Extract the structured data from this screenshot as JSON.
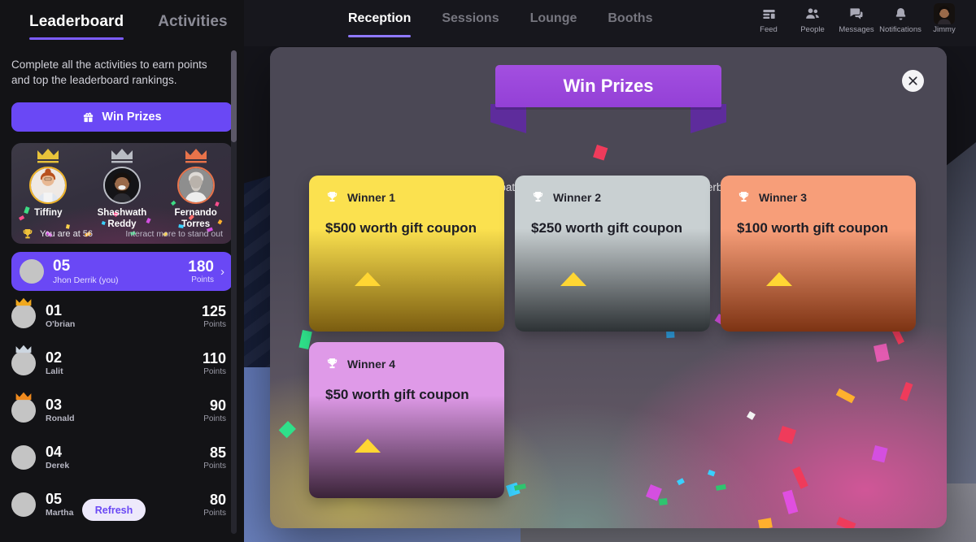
{
  "sidebar": {
    "tabs": [
      {
        "label": "Leaderboard",
        "active": true
      },
      {
        "label": "Activities",
        "active": false
      }
    ],
    "description": "Complete all the activities to earn points and top the leaderboard rankings.",
    "win_prizes_label": "Win Prizes",
    "win_prizes_icon": "gift-icon",
    "podium": [
      {
        "name": "Tiffiny",
        "medal": "gold",
        "crown_color": "#e8c33a"
      },
      {
        "name": "Shashwath Reddy",
        "medal": "silver",
        "crown_color": "#b9bcc4"
      },
      {
        "name": "Fernando Torres",
        "medal": "bronze",
        "crown_color": "#e8734a"
      }
    ],
    "podium_status": "You are at 56",
    "podium_status_icon": "trophy-icon",
    "podium_hint": "Interact more to stand out",
    "self": {
      "rank": "05",
      "name": "Jhon Derrik (you)",
      "points": "180",
      "points_label": "Points",
      "chevron": "›"
    },
    "list": [
      {
        "rank": "01",
        "name": "O'brian",
        "points": "125",
        "points_label": "Points",
        "crown": "gold"
      },
      {
        "rank": "02",
        "name": "Lalit",
        "points": "110",
        "points_label": "Points",
        "crown": "silver"
      },
      {
        "rank": "03",
        "name": "Ronald",
        "points": "90",
        "points_label": "Points",
        "crown": "bronze"
      },
      {
        "rank": "04",
        "name": "Derek",
        "points": "85",
        "points_label": "Points",
        "crown": "none"
      },
      {
        "rank": "05",
        "name": "Martha",
        "points": "80",
        "points_label": "Points",
        "crown": "none"
      }
    ],
    "refresh_label": "Refresh"
  },
  "topnav": {
    "tabs": [
      {
        "label": "Reception",
        "active": true
      },
      {
        "label": "Sessions",
        "active": false
      },
      {
        "label": "Lounge",
        "active": false
      },
      {
        "label": "Booths",
        "active": false
      }
    ],
    "actions": [
      {
        "label": "Feed",
        "icon": "feed-icon"
      },
      {
        "label": "People",
        "icon": "people-icon"
      },
      {
        "label": "Messages",
        "icon": "messages-icon"
      },
      {
        "label": "Notifications",
        "icon": "bell-icon"
      }
    ],
    "user": {
      "label": "Jimmy",
      "icon": "avatar"
    }
  },
  "modal": {
    "title": "Win Prizes",
    "subtitle": "Participate actively to win points and top the leaderboard.",
    "close_icon": "close-icon",
    "prizes": [
      {
        "winner": "Winner 1",
        "prize": "$500 worth gift coupon",
        "icon": "trophy-icon",
        "color_top": "#fbe14f",
        "color_bottom": "#7a5c10"
      },
      {
        "winner": "Winner 2",
        "prize": "$250 worth gift coupon",
        "icon": "trophy-icon",
        "color_top": "#c9d0d2",
        "color_bottom": "#2d3235"
      },
      {
        "winner": "Winner 3",
        "prize": "$100 worth gift coupon",
        "icon": "trophy-icon",
        "color_top": "#f79e79",
        "color_bottom": "#7d3313"
      },
      {
        "winner": "Winner 4",
        "prize": "$50 worth gift coupon",
        "icon": "trophy-icon",
        "color_top": "#df9ae8",
        "color_bottom": "#3a2338"
      }
    ]
  },
  "colors": {
    "accent": "#6a48f5",
    "accent_light": "#8f79ff",
    "ribbon": "#9340d6",
    "sidebar_bg": "#131316"
  }
}
